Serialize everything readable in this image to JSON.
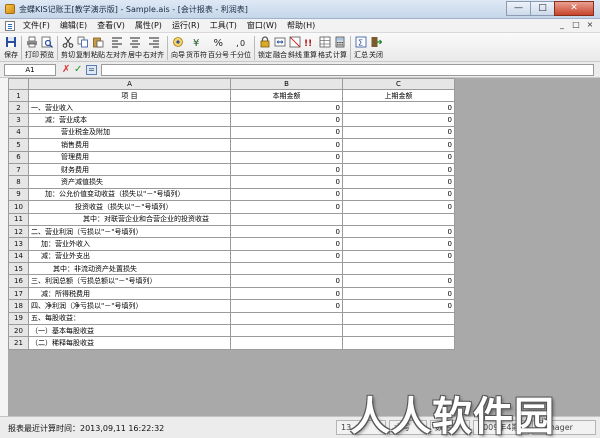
{
  "window": {
    "title": "金蝶KIS记账王[教学演示版] - Sample.ais - [会计报表 - 利润表]",
    "minimize": "—",
    "maximize": "□",
    "close": "✕"
  },
  "menu": {
    "items": [
      "文件(F)",
      "编辑(E)",
      "查看(V)",
      "属性(P)",
      "运行(R)",
      "工具(T)",
      "窗口(W)",
      "帮助(H)"
    ],
    "mdi": [
      "_",
      "□",
      "×"
    ]
  },
  "toolbar": {
    "buttons": [
      {
        "label": "保存",
        "icon": "floppy-icon"
      },
      {
        "label": "打印",
        "icon": "printer-icon"
      },
      {
        "label": "预览",
        "icon": "preview-icon"
      },
      {
        "label": "剪切",
        "icon": "scissors-icon"
      },
      {
        "label": "复制",
        "icon": "copy-icon"
      },
      {
        "label": "粘贴",
        "icon": "paste-icon"
      },
      {
        "label": "左对齐",
        "icon": "align-left-icon"
      },
      {
        "label": "居中",
        "icon": "align-center-icon"
      },
      {
        "label": "右对齐",
        "icon": "align-right-icon"
      },
      {
        "label": "向导",
        "icon": "wizard-icon"
      },
      {
        "label": "货币符",
        "icon": "currency-icon"
      },
      {
        "label": "百分号",
        "icon": "percent-icon"
      },
      {
        "label": "千分位",
        "icon": "thousands-icon"
      },
      {
        "label": "锁定",
        "icon": "lock-icon"
      },
      {
        "label": "融合",
        "icon": "merge-icon"
      },
      {
        "label": "斜线",
        "icon": "diagonal-icon"
      },
      {
        "label": "重算",
        "icon": "recalc-icon"
      },
      {
        "label": "格式",
        "icon": "format-icon"
      },
      {
        "label": "计算",
        "icon": "calculator-icon"
      },
      {
        "label": "汇总",
        "icon": "summary-icon"
      },
      {
        "label": "关闭",
        "icon": "exit-icon"
      }
    ]
  },
  "formula_bar": {
    "cell_ref": "A1",
    "cancel": "✗",
    "confirm": "✓",
    "equals": "=",
    "value": ""
  },
  "sheet": {
    "columns": [
      "",
      "A",
      "B",
      "C"
    ],
    "headers": {
      "a": "项        目",
      "b": "本期金额",
      "c": "上期金额"
    },
    "rows": [
      {
        "n": "2",
        "label": "一、营业收入",
        "b": "0",
        "c": "0"
      },
      {
        "n": "3",
        "label": "减：营业成本",
        "b": "0",
        "c": "0"
      },
      {
        "n": "4",
        "label": "营业税金及附加",
        "b": "0",
        "c": "0"
      },
      {
        "n": "5",
        "label": "销售费用",
        "b": "0",
        "c": "0"
      },
      {
        "n": "6",
        "label": "管理费用",
        "b": "0",
        "c": "0"
      },
      {
        "n": "7",
        "label": "财务费用",
        "b": "0",
        "c": "0"
      },
      {
        "n": "8",
        "label": "资产减值损失",
        "b": "0",
        "c": "0"
      },
      {
        "n": "9",
        "label": "加：公允价值变动收益（损失以\"－\"号填列）",
        "b": "0",
        "c": "0"
      },
      {
        "n": "10",
        "label": "投资收益（损失以\"－\"号填列）",
        "b": "0",
        "c": "0"
      },
      {
        "n": "11",
        "label": "其中：对联营企业和合营企业的投资收益",
        "b": "",
        "c": ""
      },
      {
        "n": "12",
        "label": "二、营业利润（亏损以\"－\"号填列）",
        "b": "0",
        "c": "0"
      },
      {
        "n": "13",
        "label": "加：营业外收入",
        "b": "0",
        "c": "0"
      },
      {
        "n": "14",
        "label": "减：营业外支出",
        "b": "0",
        "c": "0"
      },
      {
        "n": "15",
        "label": "其中：非流动资产处置损失",
        "b": "",
        "c": ""
      },
      {
        "n": "16",
        "label": "三、利润总额（亏损总额以\"－\"号填列）",
        "b": "0",
        "c": "0"
      },
      {
        "n": "17",
        "label": "减：所得税费用",
        "b": "0",
        "c": "0"
      },
      {
        "n": "18",
        "label": "四、净利润（净亏损以\"－\"号填列）",
        "b": "0",
        "c": "0"
      },
      {
        "n": "19",
        "label": "五、每股收益：",
        "b": "",
        "c": ""
      },
      {
        "n": "20",
        "label": "（一）基本每股收益",
        "b": "",
        "c": ""
      },
      {
        "n": "21",
        "label": "（二）稀释每股收益",
        "b": "",
        "c": ""
      }
    ]
  },
  "status": {
    "text": "报表最近计算时间：2013,09,11 16:22:32",
    "panel1": "13",
    "panel2": "大写",
    "panel3": "数字",
    "panel4": "2009年4期",
    "panel5": "manager"
  },
  "watermark": "人人软件园"
}
